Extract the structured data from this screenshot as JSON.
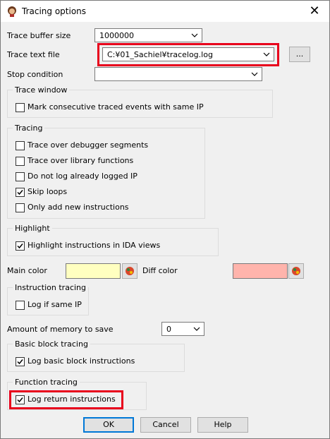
{
  "window": {
    "title": "Tracing options"
  },
  "fields": {
    "buffer_size": {
      "label": "Trace buffer size",
      "value": "1000000"
    },
    "text_file": {
      "label": "Trace text file",
      "value": "C:¥01_Sachiel¥tracelog.log",
      "browse": "..."
    },
    "stop_condition": {
      "label": "Stop condition",
      "value": ""
    }
  },
  "trace_window": {
    "title": "Trace window",
    "items": [
      {
        "label": "Mark consecutive traced events with same IP",
        "checked": false
      }
    ]
  },
  "tracing": {
    "title": "Tracing",
    "items": [
      {
        "label": "Trace over debugger segments",
        "checked": false
      },
      {
        "label": "Trace over library functions",
        "checked": false
      },
      {
        "label": "Do not log already logged IP",
        "checked": false
      },
      {
        "label": "Skip loops",
        "checked": true
      },
      {
        "label": "Only add new instructions",
        "checked": false
      }
    ]
  },
  "highlight": {
    "title": "Highlight",
    "items": [
      {
        "label": "Highlight instructions in IDA views",
        "checked": true
      }
    ]
  },
  "colors": {
    "main_label": "Main color",
    "main_value": "#ffffc0",
    "diff_label": "Diff color",
    "diff_value": "#ffb4ac"
  },
  "instruction_tracing": {
    "title": "Instruction tracing",
    "items": [
      {
        "label": "Log if same IP",
        "checked": false
      }
    ]
  },
  "memory": {
    "label": "Amount of memory to save",
    "value": "0"
  },
  "basic_block": {
    "title": "Basic block tracing",
    "items": [
      {
        "label": "Log basic block instructions",
        "checked": true
      }
    ]
  },
  "function_tracing": {
    "title": "Function tracing",
    "items": [
      {
        "label": "Log return instructions",
        "checked": true
      }
    ]
  },
  "buttons": {
    "ok": "OK",
    "cancel": "Cancel",
    "help": "Help"
  }
}
